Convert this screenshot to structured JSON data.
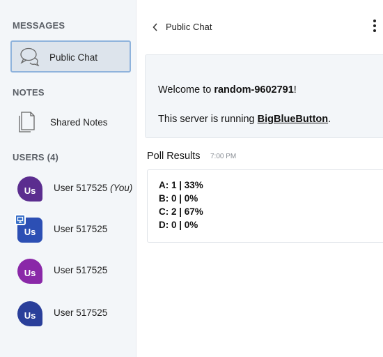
{
  "sidebar": {
    "messages_title": "MESSAGES",
    "public_chat_label": "Public Chat",
    "notes_title": "NOTES",
    "shared_notes_label": "Shared Notes",
    "users_title": "USERS (4)",
    "users": [
      {
        "initials": "Us",
        "name": "User 517525",
        "suffix": "(You)",
        "color": "#5b2d8f"
      },
      {
        "initials": "Us",
        "name": "User 517525",
        "suffix": "",
        "color": "#2c4fb4",
        "presenter": true
      },
      {
        "initials": "Us",
        "name": "User 517525",
        "suffix": "",
        "color": "#8a28a8"
      },
      {
        "initials": "Us",
        "name": "User 517525",
        "suffix": "",
        "color": "#2a3f9a"
      }
    ]
  },
  "chat": {
    "header_title": "Public Chat",
    "welcome_prefix": "Welcome to ",
    "server_name": "random-9602791",
    "welcome_suffix": "!",
    "running_prefix": "This server is running ",
    "running_link": "BigBlueButton",
    "running_suffix": ".",
    "poll_title": "Poll Results",
    "poll_time": "7:00 PM",
    "poll_lines": [
      "A: 1 | 33%",
      "B: 0 | 0%",
      "C: 2 | 67%",
      "D: 0 | 0%"
    ]
  },
  "colors": {
    "sidebar_bg": "#f3f6f9",
    "selected_border": "#8fb3dc",
    "presenter_badge": "#3870c8"
  }
}
